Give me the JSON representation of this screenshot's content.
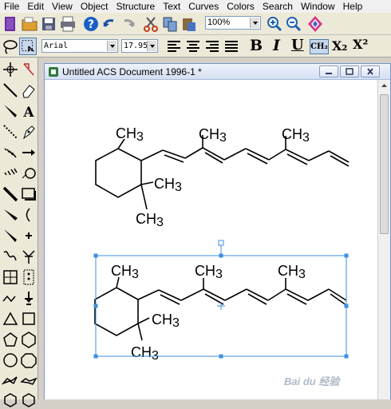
{
  "menu": [
    "File",
    "Edit",
    "View",
    "Object",
    "Structure",
    "Text",
    "Curves",
    "Colors",
    "Search",
    "Window",
    "Help"
  ],
  "toolbar": {
    "font_name": "Arial",
    "font_size": "17.95",
    "zoom": "100%",
    "bold": "B",
    "italic": "I",
    "underline": "U",
    "chemical_format": "CH₂",
    "subscript": "X₂",
    "superscript": "X²"
  },
  "document": {
    "title": "Untitled ACS Document 1996-1 *"
  },
  "labels": {
    "ch3": "CH3",
    "ch3_main": "CH",
    "ch3_sub": "3"
  },
  "watermark": "Bai du 经验",
  "colors": {
    "selection": "#3d8fe0",
    "toolbar_bg": "#ece9d8",
    "title_grad_top": "#eef3fb",
    "title_grad_bottom": "#d5e0f1"
  }
}
